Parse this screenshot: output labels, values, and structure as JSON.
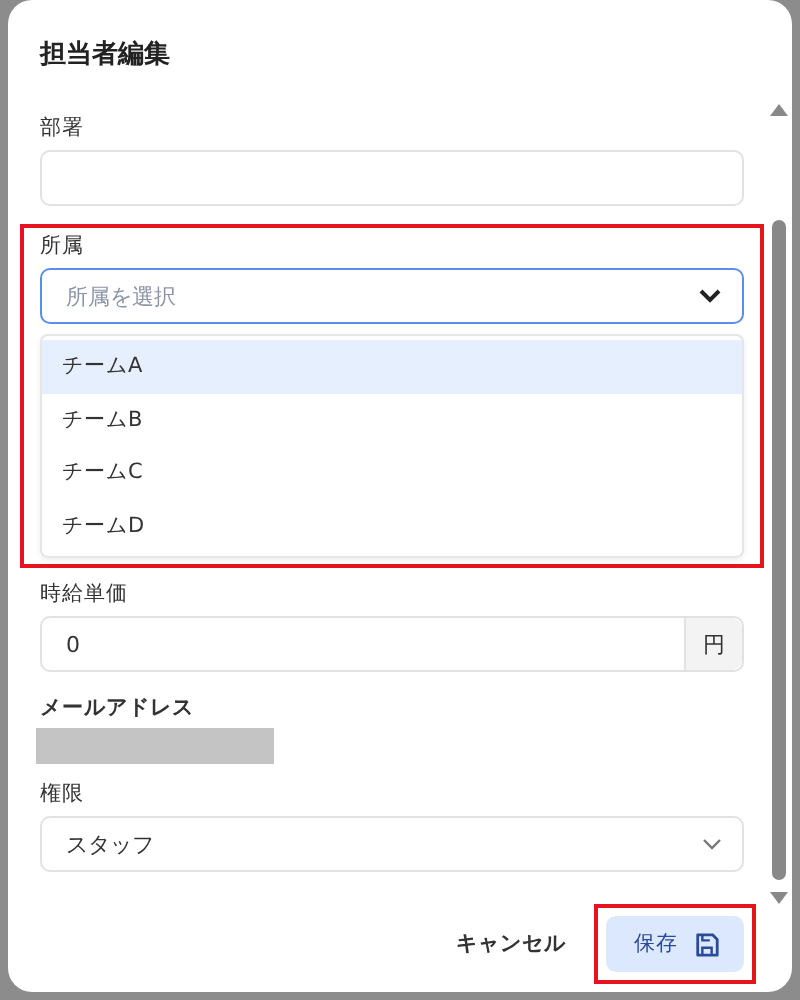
{
  "dialog": {
    "title": "担当者編集"
  },
  "department": {
    "label": "部署"
  },
  "affiliation": {
    "label": "所属",
    "placeholder": "所属を選択",
    "expanded": true,
    "highlighted": true,
    "options": [
      {
        "label": "チームA",
        "selected": true
      },
      {
        "label": "チームB",
        "selected": false
      },
      {
        "label": "チームC",
        "selected": false
      },
      {
        "label": "チームD",
        "selected": false
      }
    ]
  },
  "hourly_rate": {
    "label": "時給単価",
    "value": "0",
    "unit": "円"
  },
  "email": {
    "label": "メールアドレス",
    "redacted": true
  },
  "role": {
    "label": "権限",
    "value": "スタッフ"
  },
  "buttons": {
    "cancel": "キャンセル",
    "save": {
      "label": "保存",
      "highlighted": true
    }
  }
}
